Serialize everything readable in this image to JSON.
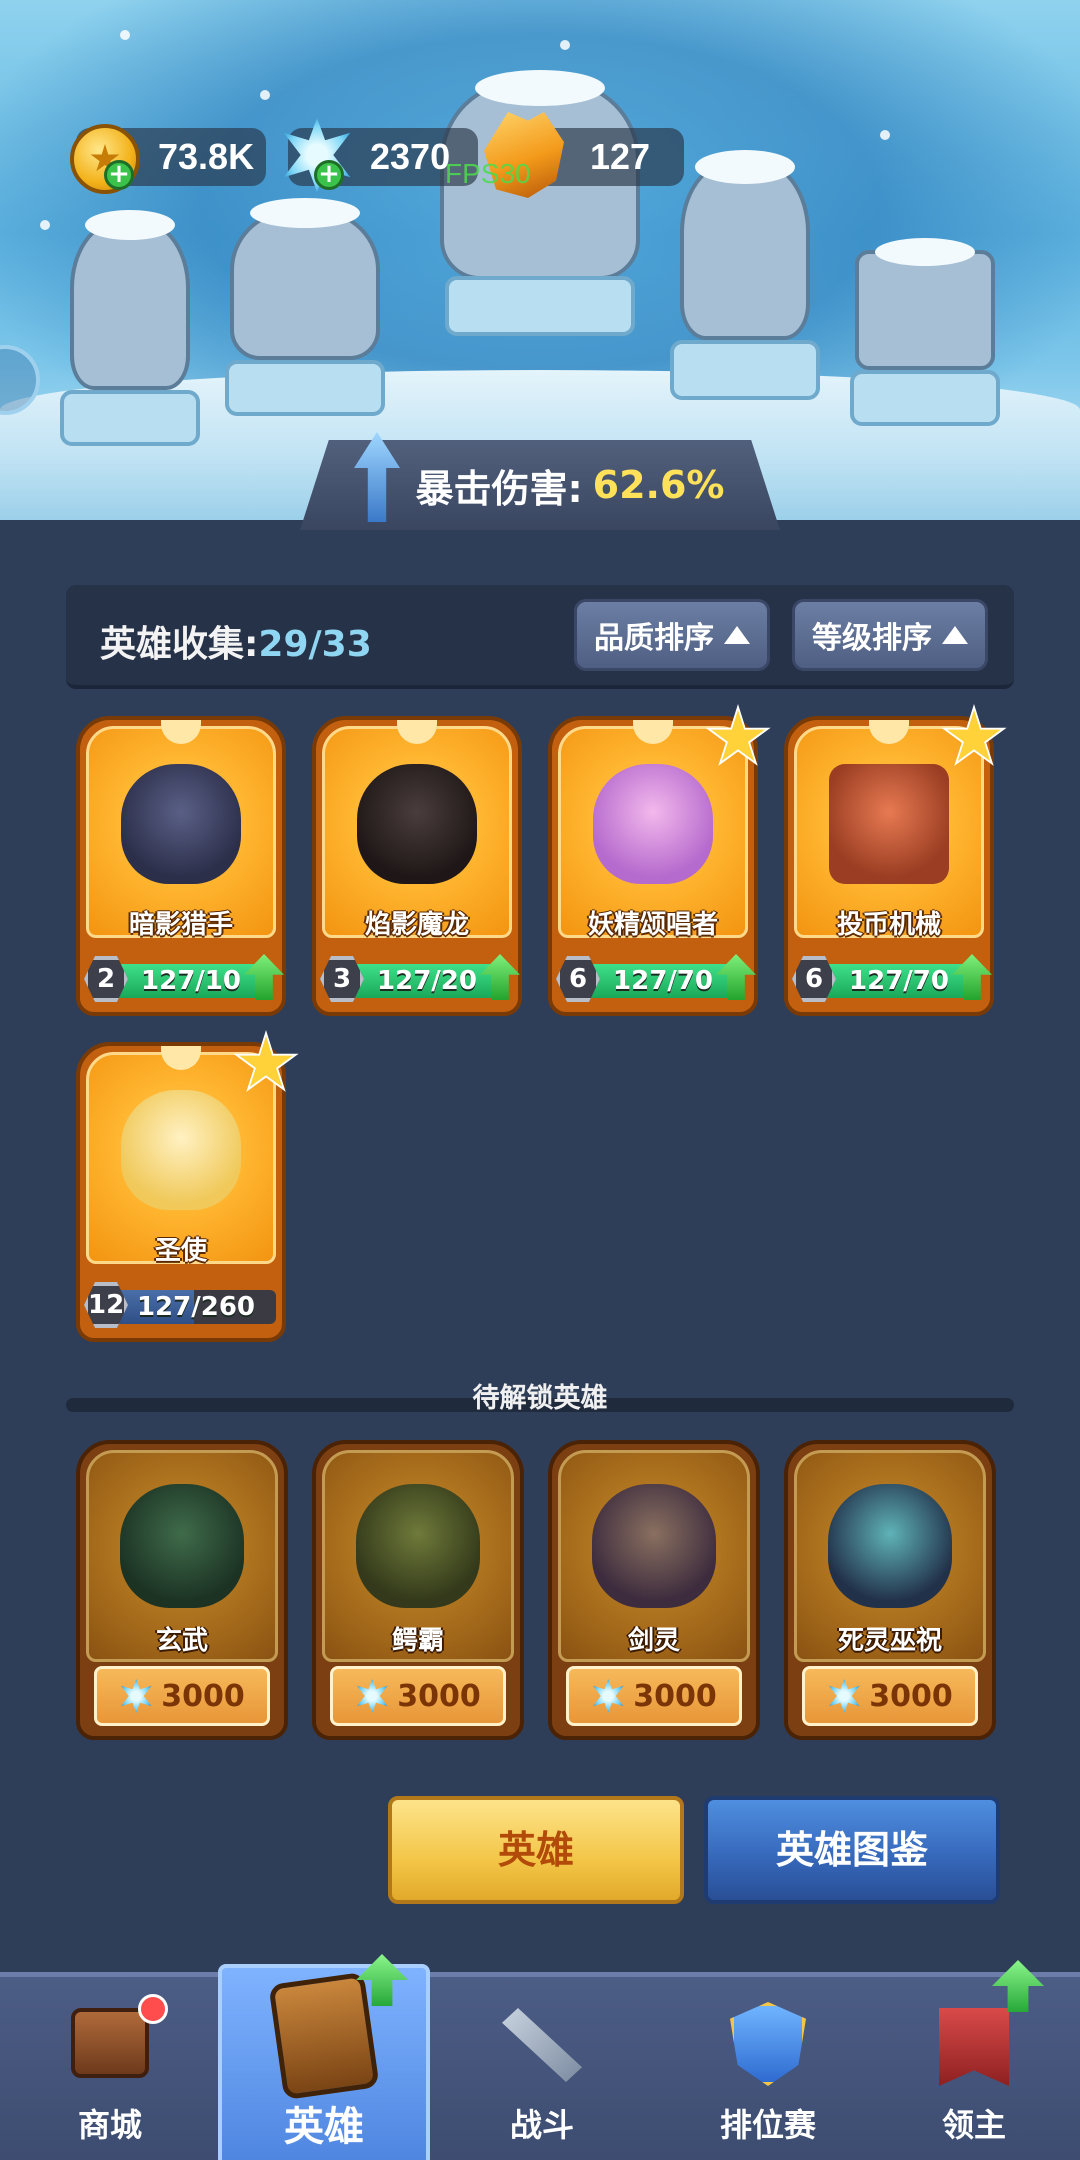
{
  "resources": {
    "gold": "73.8K",
    "crystal": "2370",
    "amber": "127",
    "fps": "FPS30"
  },
  "banner": {
    "crit_label": "暴击伤害:",
    "crit_value": "62.6%"
  },
  "collection": {
    "title": "英雄收集:",
    "count": "29/33",
    "sort_quality": "品质排序",
    "sort_level": "等级排序"
  },
  "owned_heroes": [
    {
      "name": "暗影猎手",
      "level": "2",
      "progress": "127/10",
      "fill": 1.0,
      "star": false,
      "upgrade": true
    },
    {
      "name": "焰影魔龙",
      "level": "3",
      "progress": "127/20",
      "fill": 1.0,
      "star": false,
      "upgrade": true
    },
    {
      "name": "妖精颂唱者",
      "level": "6",
      "progress": "127/70",
      "fill": 1.0,
      "star": true,
      "upgrade": true
    },
    {
      "name": "投币机械",
      "level": "6",
      "progress": "127/70",
      "fill": 1.0,
      "star": true,
      "upgrade": true
    },
    {
      "name": "圣使",
      "level": "12",
      "progress": "127/260",
      "fill": 0.49,
      "star": true,
      "upgrade": false
    }
  ],
  "locked_section_title": "待解锁英雄",
  "locked_heroes": [
    {
      "name": "玄武",
      "price": "3000"
    },
    {
      "name": "鳄霸",
      "price": "3000"
    },
    {
      "name": "剑灵",
      "price": "3000"
    },
    {
      "name": "死灵巫祝",
      "price": "3000"
    }
  ],
  "actions": {
    "hero": "英雄",
    "codex": "英雄图鉴"
  },
  "nav": {
    "shop": "商城",
    "hero": "英雄",
    "battle": "战斗",
    "ranked": "排位赛",
    "lord": "领主"
  },
  "colors": {
    "background": "#2f3e58",
    "crit_value": "#ffe15a",
    "progress_fill": "#19a859",
    "hero_button": "#f3c648",
    "codex_button": "#3566b8"
  }
}
